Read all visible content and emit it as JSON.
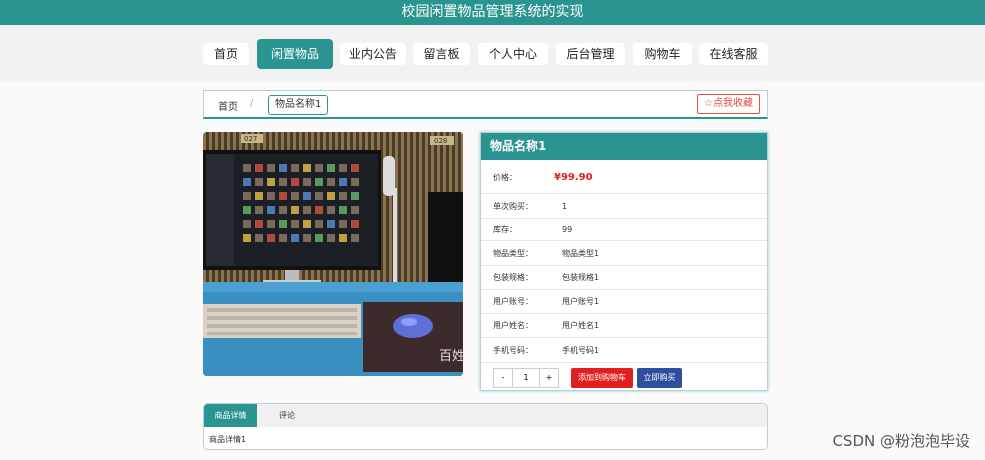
{
  "header": {
    "title": "校园闲置物品管理系统的实现"
  },
  "nav": {
    "items": [
      "首页",
      "闲置物品",
      "业内公告",
      "留言板",
      "个人中心",
      "后台管理",
      "购物车",
      "在线客服"
    ]
  },
  "breadcrumb": {
    "home": "首页",
    "separator": "/",
    "current": "物品名称1",
    "favorite": "☆点我收藏"
  },
  "photo": {
    "caption": "百姓",
    "top_label_left": "027",
    "top_label_right": "028"
  },
  "product": {
    "title": "物品名称1",
    "price_label": "价格：",
    "price": "¥99.90",
    "rows": [
      {
        "label": "单次购买：",
        "value": "1"
      },
      {
        "label": "库存：",
        "value": "99"
      },
      {
        "label": "物品类型：",
        "value": "物品类型1"
      },
      {
        "label": "包装规格：",
        "value": "包装规格1"
      },
      {
        "label": "用户账号：",
        "value": "用户账号1"
      },
      {
        "label": "用户姓名：",
        "value": "用户姓名1"
      },
      {
        "label": "手机号码：",
        "value": "手机号码1"
      }
    ],
    "qty_minus": "-",
    "qty_value": "1",
    "qty_plus": "+",
    "add_cart": "添加到购物车",
    "buy_now": "立即购买"
  },
  "tabs": {
    "detail": "商品详情",
    "comments": "评论",
    "detail_content": "商品详情1"
  },
  "watermark": "CSDN @粉泡泡毕设",
  "colors": {
    "primary": "#2a9590",
    "price": "#e02020",
    "buy": "#2d4f9e"
  }
}
